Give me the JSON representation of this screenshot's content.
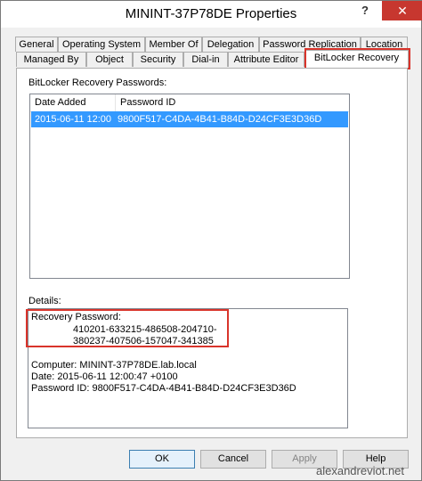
{
  "window": {
    "title": "MININT-37P78DE Properties"
  },
  "titlebar": {
    "help_glyph": "?",
    "close_glyph": "✕"
  },
  "tabs": {
    "row1": [
      "General",
      "Operating System",
      "Member Of",
      "Delegation",
      "Password Replication",
      "Location"
    ],
    "row2": [
      "Managed By",
      "Object",
      "Security",
      "Dial-in",
      "Attribute Editor",
      "BitLocker Recovery"
    ]
  },
  "recovery": {
    "section_label": "BitLocker Recovery Passwords:",
    "columns": [
      "Date Added",
      "Password ID"
    ],
    "rows": [
      {
        "date": "2015-06-11 12:00",
        "id": "9800F517-C4DA-4B41-B84D-D24CF3E3D36D"
      }
    ]
  },
  "details": {
    "label": "Details:",
    "password_label": "Recovery Password:",
    "password_line1": "410201-633215-486508-204710-",
    "password_line2": "380237-407506-157047-341385",
    "computer": "Computer: MININT-37P78DE.lab.local",
    "date": "Date: 2015-06-11 12:00:47 +0100",
    "password_id": "Password ID: 9800F517-C4DA-4B41-B84D-D24CF3E3D36D"
  },
  "buttons": {
    "ok": "OK",
    "cancel": "Cancel",
    "apply": "Apply",
    "help": "Help"
  },
  "watermark": "alexandreviot.net",
  "colors": {
    "selection": "#3399ff",
    "highlight": "#d9342b",
    "close": "#c7372f"
  }
}
